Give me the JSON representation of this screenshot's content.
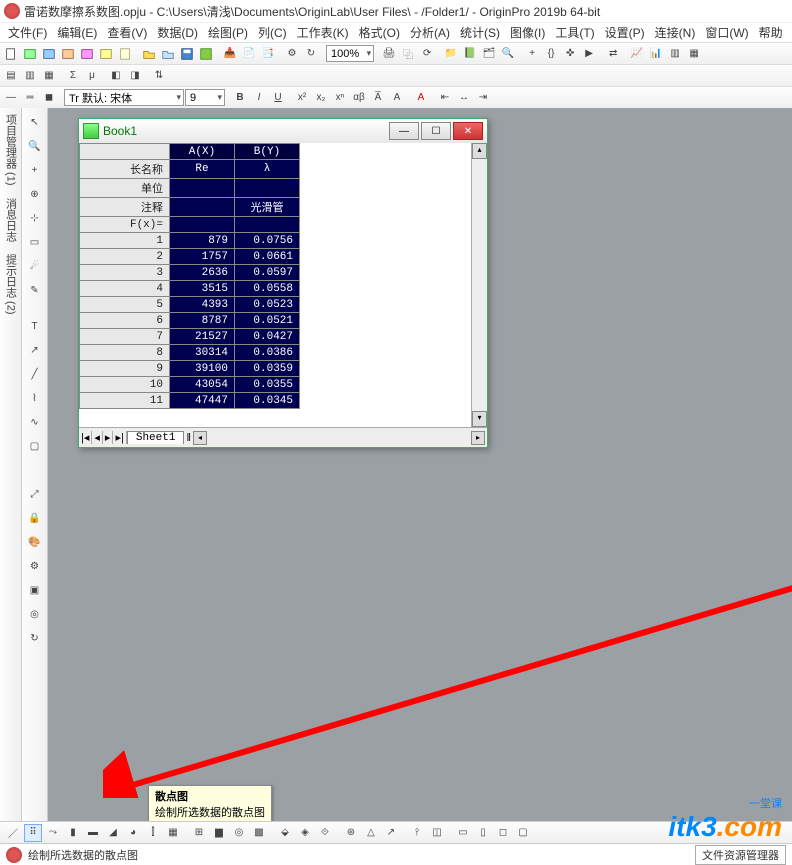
{
  "titlebar": {
    "text": "雷诺数摩擦系数图.opju - C:\\Users\\清浅\\Documents\\OriginLab\\User Files\\ - /Folder1/ - OriginPro 2019b 64-bit"
  },
  "menu": {
    "items": [
      "文件(F)",
      "编辑(E)",
      "查看(V)",
      "数据(D)",
      "绘图(P)",
      "列(C)",
      "工作表(K)",
      "格式(O)",
      "分析(A)",
      "统计(S)",
      "图像(I)",
      "工具(T)",
      "设置(P)",
      "连接(N)",
      "窗口(W)",
      "帮助"
    ]
  },
  "toolbar2": {
    "zoom": "100%",
    "fontlabel": "Tr 默认: 宋体",
    "fontsize": "9"
  },
  "sideTabs": [
    "项目管理器 (1)",
    "消息日志",
    "提示日志 (2)"
  ],
  "book": {
    "title": "Book1",
    "cols": [
      "A(X)",
      "B(Y)"
    ],
    "metaRows": [
      "长名称",
      "单位",
      "注释",
      "F(x)="
    ],
    "metaVals": [
      [
        "Re",
        "λ"
      ],
      [
        "",
        ""
      ],
      [
        "",
        "光滑管"
      ],
      [
        "",
        ""
      ]
    ],
    "rows": [
      {
        "n": "1",
        "a": "879",
        "b": "0.0756"
      },
      {
        "n": "2",
        "a": "1757",
        "b": "0.0661"
      },
      {
        "n": "3",
        "a": "2636",
        "b": "0.0597"
      },
      {
        "n": "4",
        "a": "3515",
        "b": "0.0558"
      },
      {
        "n": "5",
        "a": "4393",
        "b": "0.0523"
      },
      {
        "n": "6",
        "a": "8787",
        "b": "0.0521"
      },
      {
        "n": "7",
        "a": "21527",
        "b": "0.0427"
      },
      {
        "n": "8",
        "a": "30314",
        "b": "0.0386"
      },
      {
        "n": "9",
        "a": "39100",
        "b": "0.0359"
      },
      {
        "n": "10",
        "a": "43054",
        "b": "0.0355"
      },
      {
        "n": "11",
        "a": "47447",
        "b": "0.0345"
      }
    ],
    "sheet": "Sheet1"
  },
  "tooltip": {
    "title": "散点图",
    "desc": "绘制所选数据的散点图"
  },
  "status": {
    "text": "绘制所选数据的散点图",
    "field": "文件资源管理器"
  },
  "watermark": {
    "main1": "itk3",
    "main2": ".com",
    "sub": "一堂课"
  },
  "fmtBtns": {
    "b": "B",
    "i": "I",
    "u": "U"
  }
}
